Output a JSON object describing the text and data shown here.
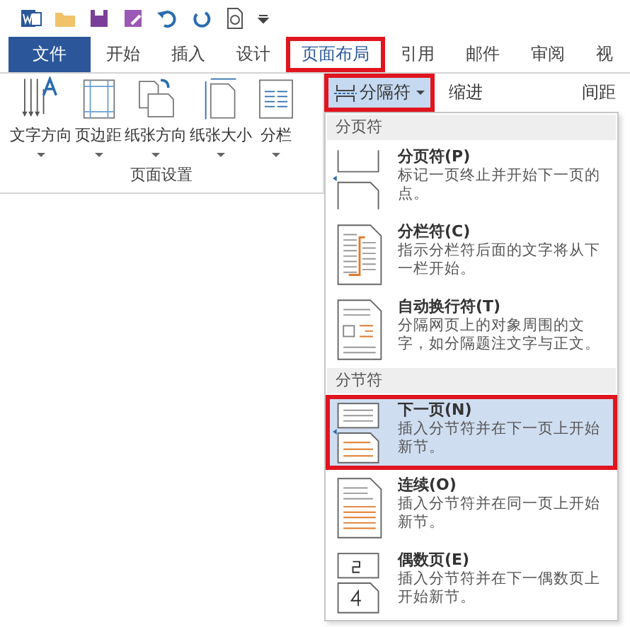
{
  "file_tab": {
    "label": "文件"
  },
  "tabs": [
    {
      "label": "开始",
      "selected": false
    },
    {
      "label": "插入",
      "selected": false
    },
    {
      "label": "设计",
      "selected": false
    },
    {
      "label": "页面布局",
      "selected": true
    },
    {
      "label": "引用",
      "selected": false
    },
    {
      "label": "邮件",
      "selected": false
    },
    {
      "label": "审阅",
      "selected": false
    },
    {
      "label": "视",
      "selected": false
    }
  ],
  "ribbon": {
    "buttons": [
      {
        "label": "文字方向",
        "kind": "text_direction"
      },
      {
        "label": "页边距",
        "kind": "margins"
      },
      {
        "label": "纸张方向",
        "kind": "orientation"
      },
      {
        "label": "纸张大小",
        "kind": "size"
      },
      {
        "label": "分栏",
        "kind": "columns"
      }
    ],
    "group_label": "页面设置",
    "breaks_button": {
      "label": "分隔符",
      "pressed": true
    },
    "indent_label": "缩进",
    "spacing_label": "间距"
  },
  "menu": {
    "sections": [
      {
        "header": "分页符",
        "items": [
          {
            "kind": "page",
            "title": "分页符(P)",
            "description": "标记一页终止并开始下一页的点。",
            "selected": false
          },
          {
            "kind": "column",
            "title": "分栏符(C)",
            "description": "指示分栏符后面的文字将从下一栏开始。",
            "selected": false
          },
          {
            "kind": "wrap",
            "title": "自动换行符(T)",
            "description": "分隔网页上的对象周围的文字，如分隔题注文字与正文。",
            "selected": false
          }
        ]
      },
      {
        "header": "分节符",
        "items": [
          {
            "kind": "next_page",
            "title": "下一页(N)",
            "description": "插入分节符并在下一页上开始新节。",
            "selected": true
          },
          {
            "kind": "continuous",
            "title": "连续(O)",
            "description": "插入分节符并在同一页上开始新节。",
            "selected": false
          },
          {
            "kind": "even_page",
            "title": "偶数页(E)",
            "description": "插入分节符并在下一偶数页上开始新节。",
            "selected": false
          }
        ]
      }
    ]
  }
}
